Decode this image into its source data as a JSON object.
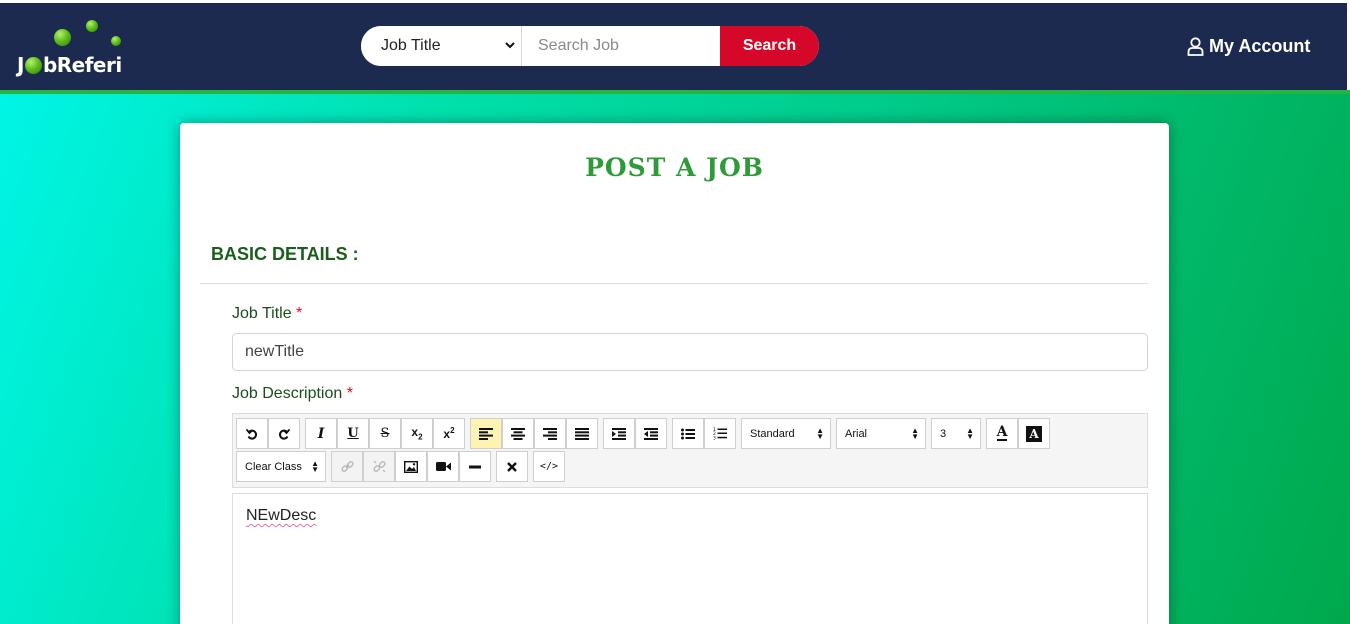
{
  "header": {
    "logo_prefix": "J",
    "logo_suffix": "bReferi",
    "search_select_value": "Job Title",
    "search_placeholder": "Search Job",
    "search_button": "Search",
    "account_label": "My Account"
  },
  "page": {
    "title": "POST A JOB",
    "section": "BASIC DETAILS :"
  },
  "form": {
    "job_title_label": "Job Title",
    "job_title_value": "newTitle",
    "job_desc_label": "Job Description",
    "required_mark": "*"
  },
  "editor": {
    "paragraph_style": "Standard",
    "font_name": "Arial",
    "font_size": "3",
    "class_select": "Clear Class",
    "content": "NEwDesc"
  },
  "colors": {
    "header_bg": "#1b2a4e",
    "search_button_bg": "#d6082a",
    "title_green": "#2f9a3a",
    "active_tool_bg": "#fdf3b3"
  }
}
